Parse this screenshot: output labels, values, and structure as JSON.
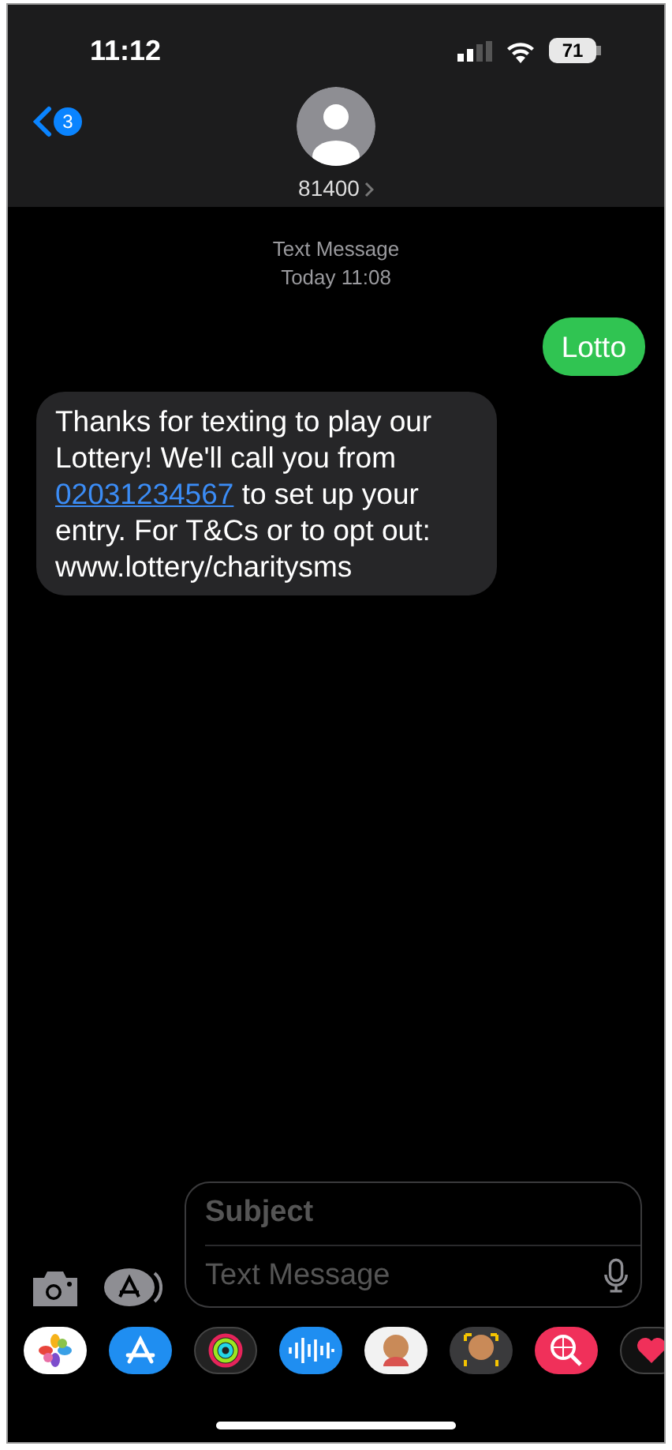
{
  "status_bar": {
    "time": "11:12",
    "battery": "71"
  },
  "header": {
    "back_badge": "3",
    "contact": "81400"
  },
  "thread_meta": {
    "service": "Text Message",
    "timestamp": "Today 11:08"
  },
  "messages": [
    {
      "kind": "sent",
      "parts": [
        {
          "kind": "text",
          "text": "Lotto"
        }
      ]
    },
    {
      "kind": "received",
      "parts": [
        {
          "kind": "text",
          "text": "Thanks for texting to play our Lottery! We'll call you from "
        },
        {
          "kind": "link",
          "text": "02031234567"
        },
        {
          "kind": "text",
          "text": " to set up your entry. For T&Cs or to opt out: www.lottery/charitysms"
        }
      ]
    }
  ],
  "compose": {
    "subject_placeholder": "Subject",
    "message_placeholder": "Text Message"
  }
}
